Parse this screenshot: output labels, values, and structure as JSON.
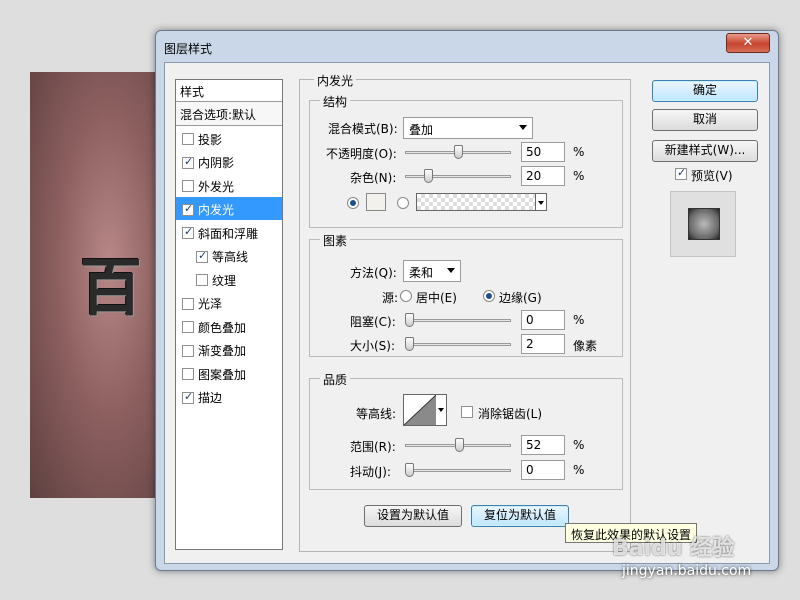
{
  "dialog": {
    "title": "图层样式",
    "close_icon": "close-icon"
  },
  "canvas": {
    "glyph": "百"
  },
  "styles": {
    "header": "样式",
    "blend": "混合选项:默认",
    "items": [
      {
        "label": "投影",
        "checked": false
      },
      {
        "label": "内阴影",
        "checked": true
      },
      {
        "label": "外发光",
        "checked": false
      },
      {
        "label": "内发光",
        "checked": true
      },
      {
        "label": "斜面和浮雕",
        "checked": true
      },
      {
        "label": "等高线",
        "checked": true
      },
      {
        "label": "纹理",
        "checked": false
      },
      {
        "label": "光泽",
        "checked": false
      },
      {
        "label": "颜色叠加",
        "checked": false
      },
      {
        "label": "渐变叠加",
        "checked": false
      },
      {
        "label": "图案叠加",
        "checked": false
      },
      {
        "label": "描边",
        "checked": true
      }
    ]
  },
  "panel": {
    "title": "内发光",
    "structure": {
      "title": "结构",
      "blend_mode_label": "混合模式(B):",
      "blend_mode_value": "叠加",
      "opacity_label": "不透明度(O):",
      "opacity_value": "50",
      "opacity_fraction": 0.5,
      "noise_label": "杂色(N):",
      "noise_value": "20",
      "noise_fraction": 0.2,
      "percent": "%"
    },
    "elements": {
      "title": "图素",
      "technique_label": "方法(Q):",
      "technique_value": "柔和",
      "source_label": "源:",
      "source_center": "居中(E)",
      "source_edge": "边缘(G)",
      "choke_label": "阻塞(C):",
      "choke_value": "0",
      "choke_fraction": 0.0,
      "size_label": "大小(S):",
      "size_value": "2",
      "size_fraction": 0.0,
      "size_unit": "像素",
      "percent": "%"
    },
    "quality": {
      "title": "品质",
      "contour_label": "等高线:",
      "anti_alias_label": "消除锯齿(L)",
      "range_label": "范围(R):",
      "range_value": "52",
      "range_fraction": 0.52,
      "jitter_label": "抖动(J):",
      "jitter_value": "0",
      "jitter_fraction": 0.0,
      "percent": "%"
    },
    "make_default": "设置为默认值",
    "reset_default": "复位为默认值"
  },
  "buttons": {
    "ok": "确定",
    "cancel": "取消",
    "new_style": "新建样式(W)...",
    "preview": "预览(V)"
  },
  "tooltip": "恢复此效果的默认设置",
  "watermark": {
    "brand": "Baidu 经验",
    "url": "jingyan.baidu.com"
  }
}
